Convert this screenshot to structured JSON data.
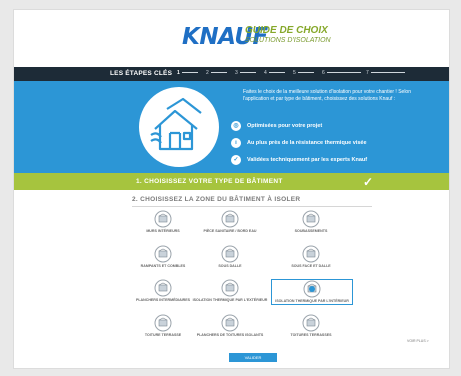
{
  "header": {
    "brand": "KNAUF",
    "guide_title": "GUIDE DE CHOIX",
    "guide_subtitle": "SOLUTIONS D'ISOLATION"
  },
  "steps": {
    "title": "LES ÉTAPES CLÉS",
    "items": [
      {
        "num": "1",
        "active": true
      },
      {
        "num": "2",
        "active": false
      },
      {
        "num": "3",
        "active": false
      },
      {
        "num": "4",
        "active": false
      },
      {
        "num": "5",
        "active": false
      },
      {
        "num": "6",
        "active": false
      },
      {
        "num": "7",
        "active": false
      }
    ]
  },
  "hero": {
    "intro": "Faites le choix de la meilleure solution d'isolation pour votre chantier ! Selon l'application et par type de bâtiment, choisissez des solutions Knauf :",
    "bullets": [
      {
        "icon": "target-icon",
        "text": "Optimisées pour votre projet"
      },
      {
        "icon": "thermometer-icon",
        "text": "Au plus près de la résistance thermique visée"
      },
      {
        "icon": "check-circle-icon",
        "text": "Validées techniquement par les experts Knauf"
      }
    ]
  },
  "step1": {
    "label": "1. CHOISISSEZ VOTRE TYPE DE BÂTIMENT"
  },
  "step2": {
    "label": "2. CHOISISSEZ LA ZONE DU BÂTIMENT À ISOLER"
  },
  "zones": [
    {
      "label": "MURS INTÉRIEURS"
    },
    {
      "label": "PIÈCE SANITAIRE / BORD EAU"
    },
    {
      "label": "SOUBASSEMENTS"
    },
    {
      "label": "RAMPANTS ET COMBLES"
    },
    {
      "label": "SOUS DALLE"
    },
    {
      "label": "SOUS FACE ET DALLE"
    },
    {
      "label": "PLANCHERS INTERMÉDIAIRES"
    },
    {
      "label": "ISOLATION THERMIQUE PAR L'EXTÉRIEUR"
    },
    {
      "label": "ISOLATION THERMIQUE PAR L'INTÉRIEUR"
    },
    {
      "label": "TOITURE TERRASSE"
    },
    {
      "label": "PLANCHERS DE TOITURES ISOLANTS"
    },
    {
      "label": "TOITURES TERRASSES"
    }
  ],
  "more_link": "VOIR PLUS >",
  "submit": "VALIDER",
  "colors": {
    "blue": "#2c96d6",
    "green": "#a6c43e",
    "dark": "#1d2b37",
    "brand": "#1f6fc4"
  }
}
